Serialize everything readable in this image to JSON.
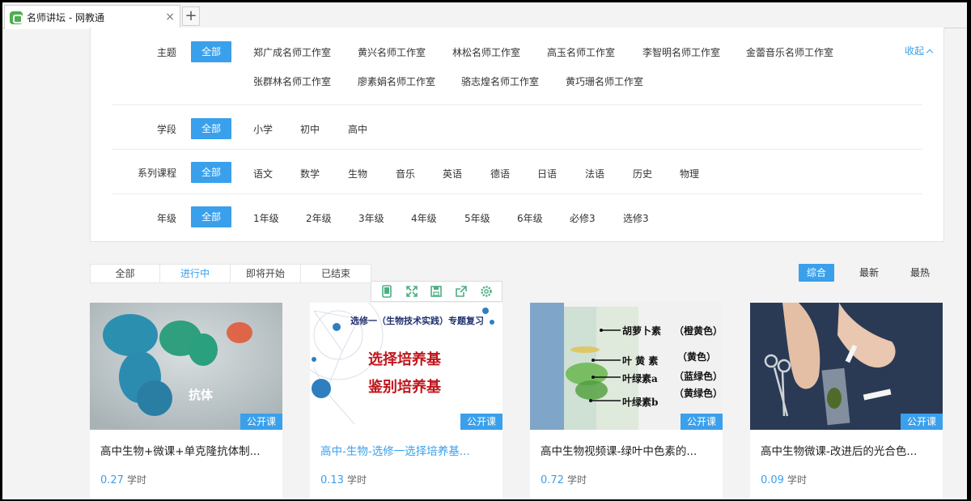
{
  "tab": {
    "title": "名师讲坛 - 网教通",
    "close": "×",
    "add": "+"
  },
  "filters": {
    "collapse_label": "收起",
    "all_label": "全部",
    "theme": {
      "label": "主题",
      "options": [
        "郑广成名师工作室",
        "黄兴名师工作室",
        "林松名师工作室",
        "高玉名师工作室",
        "李智明名师工作室",
        "金蕾音乐名师工作室",
        "张群林名师工作室",
        "廖素娟名师工作室",
        "骆志煌名师工作室",
        "黄巧珊名师工作室"
      ]
    },
    "stage": {
      "label": "学段",
      "options": [
        "小学",
        "初中",
        "高中"
      ]
    },
    "series": {
      "label": "系列课程",
      "options": [
        "语文",
        "数学",
        "生物",
        "音乐",
        "英语",
        "德语",
        "日语",
        "法语",
        "历史",
        "物理"
      ]
    },
    "grade": {
      "label": "年级",
      "options": [
        "1年级",
        "2年级",
        "3年级",
        "4年级",
        "5年级",
        "6年级",
        "必修3",
        "选修3"
      ]
    }
  },
  "status_tabs": [
    "全部",
    "进行中",
    "即将开始",
    "已结束"
  ],
  "active_status": 1,
  "sort": [
    "综合",
    "最新",
    "最热"
  ],
  "accent_color": "#3aa0ec",
  "cards": [
    {
      "title": "高中生物+微课+单克隆抗体制...",
      "hours": "0.27",
      "unit": "学时",
      "badge": "公开课",
      "thumb_text": [
        "抗体"
      ]
    },
    {
      "title": "高中-生物-选修一选择培养基...",
      "hours": "0.13",
      "unit": "学时",
      "badge": "公开课",
      "thumb_text": [
        "选修一（生物技术实践）专题复习",
        "选择培养基",
        "鉴别培养基"
      ]
    },
    {
      "title": "高中生物视频课-绿叶中色素的...",
      "hours": "0.72",
      "unit": "学时",
      "badge": "公开课",
      "thumb_text": [
        "胡萝卜素",
        "叶 黄 素",
        "叶绿素a",
        "叶绿素b",
        "（橙黄色）",
        "（黄色）",
        "（蓝绿色）",
        "（黄绿色）"
      ]
    },
    {
      "title": "高中生物微课-改进后的光合色...",
      "hours": "0.09",
      "unit": "学时",
      "badge": "公开课",
      "thumb_text": []
    }
  ],
  "toolbar_icons": [
    "tablet-icon",
    "fullscreen-icon",
    "save-icon",
    "share-icon",
    "settings-icon"
  ]
}
